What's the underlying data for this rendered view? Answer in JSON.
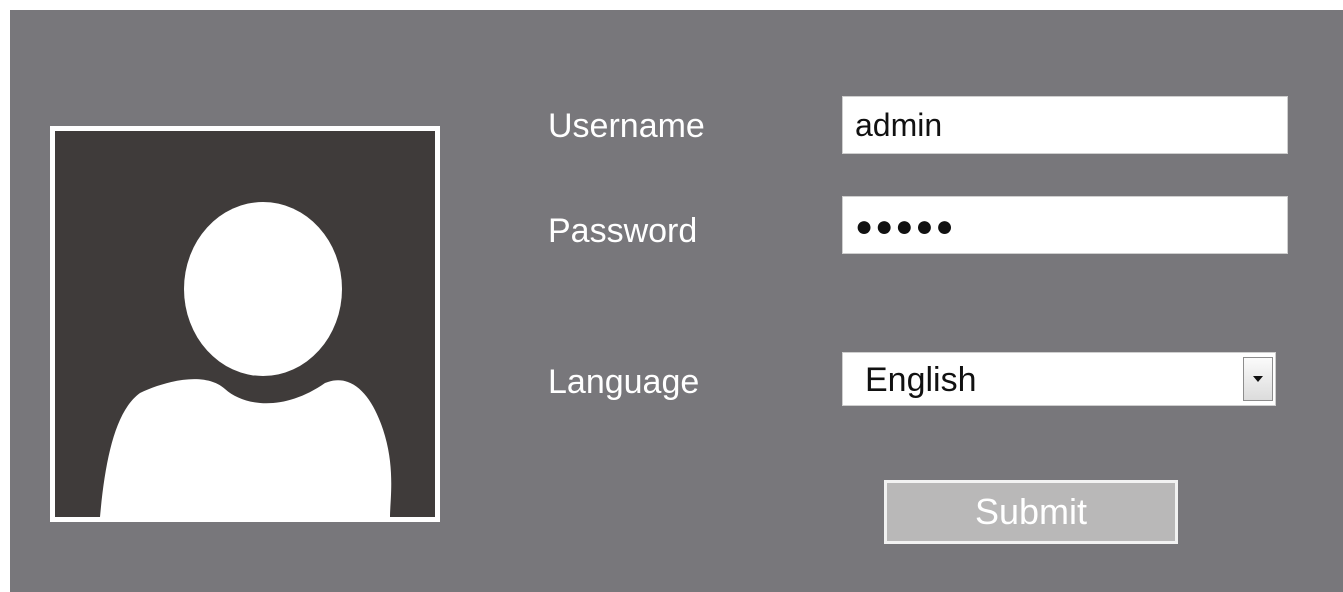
{
  "login": {
    "username_label": "Username",
    "username_value": "admin",
    "password_label": "Password",
    "password_value": "●●●●●",
    "language_label": "Language",
    "language_value": "English",
    "submit_label": "Submit"
  },
  "icons": {
    "avatar": "user-silhouette-icon",
    "dropdown": "triangle-down-icon"
  },
  "colors": {
    "panel_bg": "#78777b",
    "avatar_bg": "#3f3b3a",
    "submit_bg": "#b9b8b8"
  }
}
